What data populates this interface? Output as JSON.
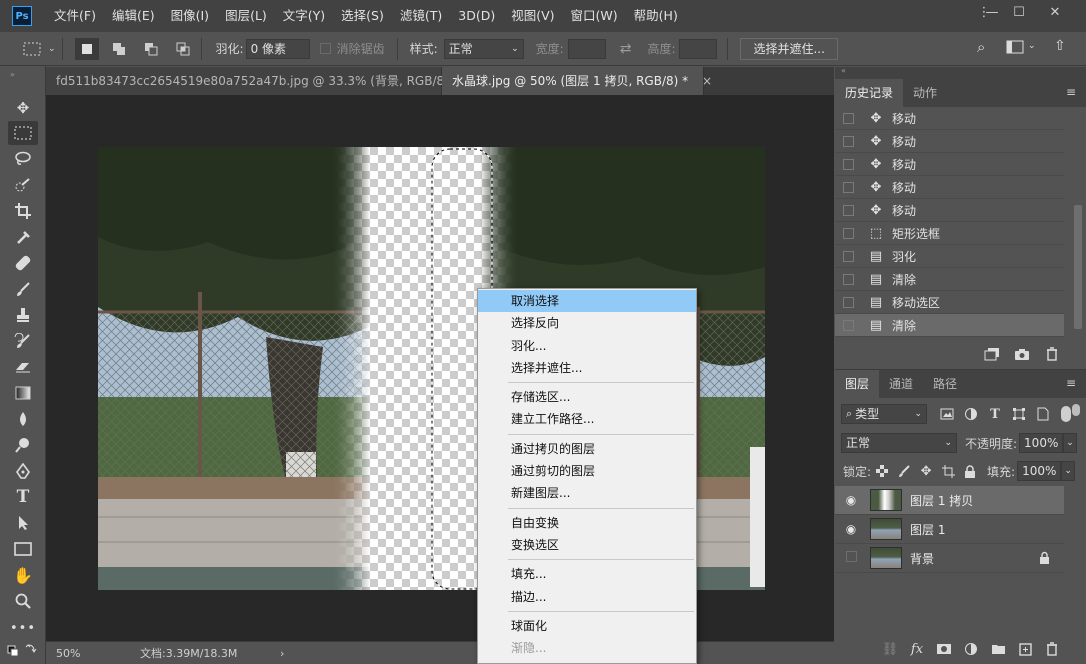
{
  "menubar": {
    "logo": "Ps",
    "items": [
      "文件(F)",
      "编辑(E)",
      "图像(I)",
      "图层(L)",
      "文字(Y)",
      "选择(S)",
      "滤镜(T)",
      "3D(D)",
      "视图(V)",
      "窗口(W)",
      "帮助(H)"
    ],
    "window_controls": [
      "⋮",
      "—",
      "☐",
      "✕"
    ]
  },
  "options": {
    "feather_label": "羽化:",
    "feather_value": "0 像素",
    "antialias_label": "消除锯齿",
    "style_label": "样式:",
    "style_value": "正常",
    "width_label": "宽度:",
    "height_label": "高度:",
    "select_mask_button": "选择并遮住..."
  },
  "tabs": [
    {
      "label": "fd511b83473cc2654519e80a752a47b.jpg @ 33.3% (背景, RGB/8) *",
      "close": "×"
    },
    {
      "label": "水晶球.jpg @ 50% (图层 1 拷贝, RGB/8) *",
      "close": "×"
    }
  ],
  "status": {
    "zoom": "50%",
    "doc": "文档:3.39M/18.3M",
    "arrow": "›"
  },
  "context_menu": {
    "groups": [
      [
        {
          "label": "取消选择",
          "highlight": true
        },
        {
          "label": "选择反向"
        },
        {
          "label": "羽化..."
        },
        {
          "label": "选择并遮住..."
        }
      ],
      [
        {
          "label": "存储选区..."
        },
        {
          "label": "建立工作路径..."
        }
      ],
      [
        {
          "label": "通过拷贝的图层"
        },
        {
          "label": "通过剪切的图层"
        },
        {
          "label": "新建图层..."
        }
      ],
      [
        {
          "label": "自由变换"
        },
        {
          "label": "变换选区"
        }
      ],
      [
        {
          "label": "填充..."
        },
        {
          "label": "描边..."
        }
      ],
      [
        {
          "label": "球面化"
        },
        {
          "label": "渐隐...",
          "disabled": true
        }
      ]
    ]
  },
  "history_panel": {
    "tabs": [
      "历史记录",
      "动作"
    ],
    "items": [
      {
        "icon": "move-icon",
        "glyph": "✥",
        "label": "移动"
      },
      {
        "icon": "move-icon",
        "glyph": "✥",
        "label": "移动"
      },
      {
        "icon": "move-icon",
        "glyph": "✥",
        "label": "移动"
      },
      {
        "icon": "move-icon",
        "glyph": "✥",
        "label": "移动"
      },
      {
        "icon": "move-icon",
        "glyph": "✥",
        "label": "移动"
      },
      {
        "icon": "marquee-icon",
        "glyph": "⬚",
        "label": "矩形选框"
      },
      {
        "icon": "document-icon",
        "glyph": "▤",
        "label": "羽化"
      },
      {
        "icon": "document-icon",
        "glyph": "▤",
        "label": "清除"
      },
      {
        "icon": "document-icon",
        "glyph": "▤",
        "label": "移动选区"
      },
      {
        "icon": "document-icon",
        "glyph": "▤",
        "label": "清除",
        "selected": true
      }
    ]
  },
  "layers_panel": {
    "tabs": [
      "图层",
      "通道",
      "路径"
    ],
    "filter_label": "类型",
    "blend_mode": "正常",
    "opacity_label": "不透明度:",
    "opacity_value": "100%",
    "lock_label": "锁定:",
    "fill_label": "填充:",
    "fill_value": "100%",
    "layers": [
      {
        "name": "图层 1 拷贝",
        "visible": true,
        "selected": true
      },
      {
        "name": "图层 1",
        "visible": true
      },
      {
        "name": "背景",
        "visible": false,
        "locked": true
      }
    ]
  },
  "colors": {
    "highlight": "#91c9f7",
    "chrome": "#535353",
    "canvas_bg": "#282828"
  }
}
